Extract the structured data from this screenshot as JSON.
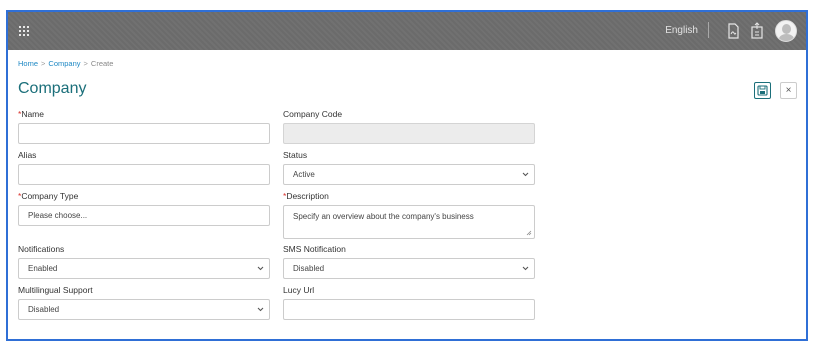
{
  "header": {
    "language": "English",
    "icons": [
      "apps-grid-icon",
      "document-sign-icon",
      "clipboard-upload-icon",
      "user-avatar-icon"
    ]
  },
  "breadcrumb": {
    "home": "Home",
    "company": "Company",
    "current": "Create",
    "separator": ">"
  },
  "page": {
    "title": "Company"
  },
  "actions": {
    "save_icon": "save-icon",
    "close_icon": "close-icon",
    "close_glyph": "×"
  },
  "form": {
    "required_mark": "*",
    "name": {
      "label": "Name",
      "value": ""
    },
    "company_code": {
      "label": "Company Code",
      "value": "",
      "disabled": true
    },
    "alias": {
      "label": "Alias",
      "value": ""
    },
    "status": {
      "label": "Status",
      "value": "Active"
    },
    "company_type": {
      "label": "Company Type",
      "value": "Please choose..."
    },
    "description": {
      "label": "Description",
      "placeholder": "Specify an overview about the company's business"
    },
    "notifications": {
      "label": "Notifications",
      "value": "Enabled"
    },
    "sms_notification": {
      "label": "SMS Notification",
      "value": "Disabled"
    },
    "multilingual_support": {
      "label": "Multilingual Support",
      "value": "Disabled"
    },
    "lucy_url": {
      "label": "Lucy Url",
      "value": ""
    }
  },
  "colors": {
    "topbar": "#6b6b6b",
    "title": "#1b6f7a",
    "link": "#1e88c4",
    "required": "#d9302b",
    "frame": "#2f6fd6"
  }
}
